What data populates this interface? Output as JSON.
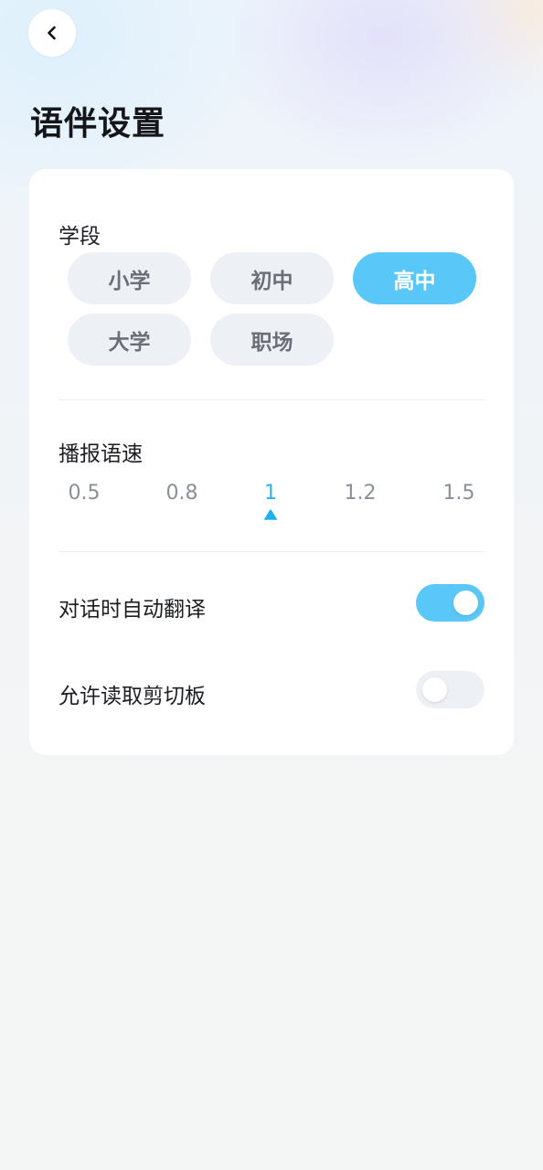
{
  "header": {
    "title": "语伴设置"
  },
  "grade": {
    "label": "学段",
    "options": [
      {
        "label": "小学",
        "selected": false
      },
      {
        "label": "初中",
        "selected": false
      },
      {
        "label": "高中",
        "selected": true
      },
      {
        "label": "大学",
        "selected": false
      },
      {
        "label": "职场",
        "selected": false
      }
    ]
  },
  "speech_speed": {
    "label": "播报语速",
    "options": [
      "0.5",
      "0.8",
      "1",
      "1.2",
      "1.5"
    ],
    "selected": "1"
  },
  "settings": [
    {
      "label": "对话时自动翻译",
      "enabled": true
    },
    {
      "label": "允许读取剪切板",
      "enabled": false
    }
  ],
  "colors": {
    "accent": "#59c8f8",
    "accent_text": "#2fb3ee",
    "pill_bg": "#edf0f4",
    "card_bg": "#ffffff"
  },
  "icons": {
    "back": "chevron-left-icon",
    "speed_marker": "triangle-up-icon"
  }
}
